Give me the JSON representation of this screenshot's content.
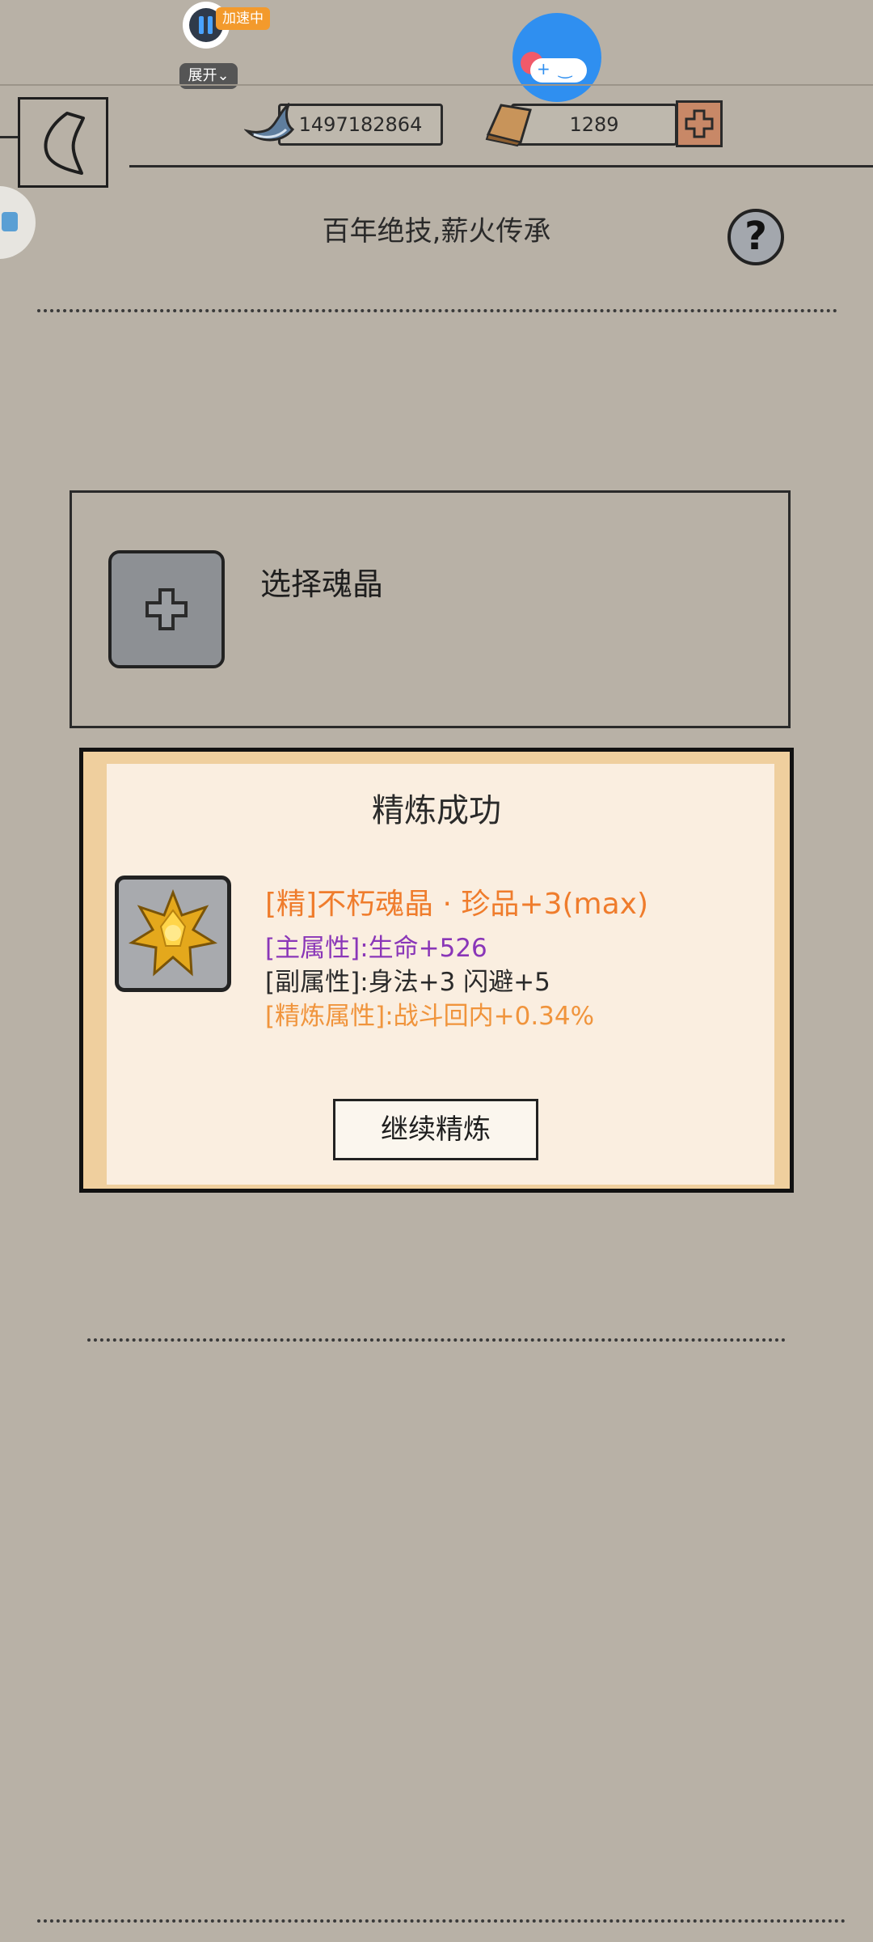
{
  "overlay": {
    "accelerator_badge": "加速中",
    "expand_label": "展开",
    "expand_icon": "chevron-down-icon"
  },
  "header": {
    "silver_amount": "1497182864",
    "gold_amount": "1289",
    "title": "百年绝技,薪火传承",
    "help_label": "?"
  },
  "select_panel": {
    "label": "选择魂晶"
  },
  "dialog": {
    "title": "精炼成功",
    "item_name": "[精]不朽魂晶 · 珍品+3(max)",
    "main_attr": "[主属性]:生命+526",
    "sub_attr": "[副属性]:身法+3 闪避+5",
    "refine_attr": "[精炼属性]:战斗回内+0.34%",
    "continue_label": "继续精炼"
  },
  "colors": {
    "background": "#b8b1a6",
    "item_name": "#ef7c2c",
    "main_attr": "#8a36b8",
    "refine_attr": "#f0943c",
    "dialog_bg": "#faeee0",
    "dialog_frame": "#efcf9e"
  }
}
